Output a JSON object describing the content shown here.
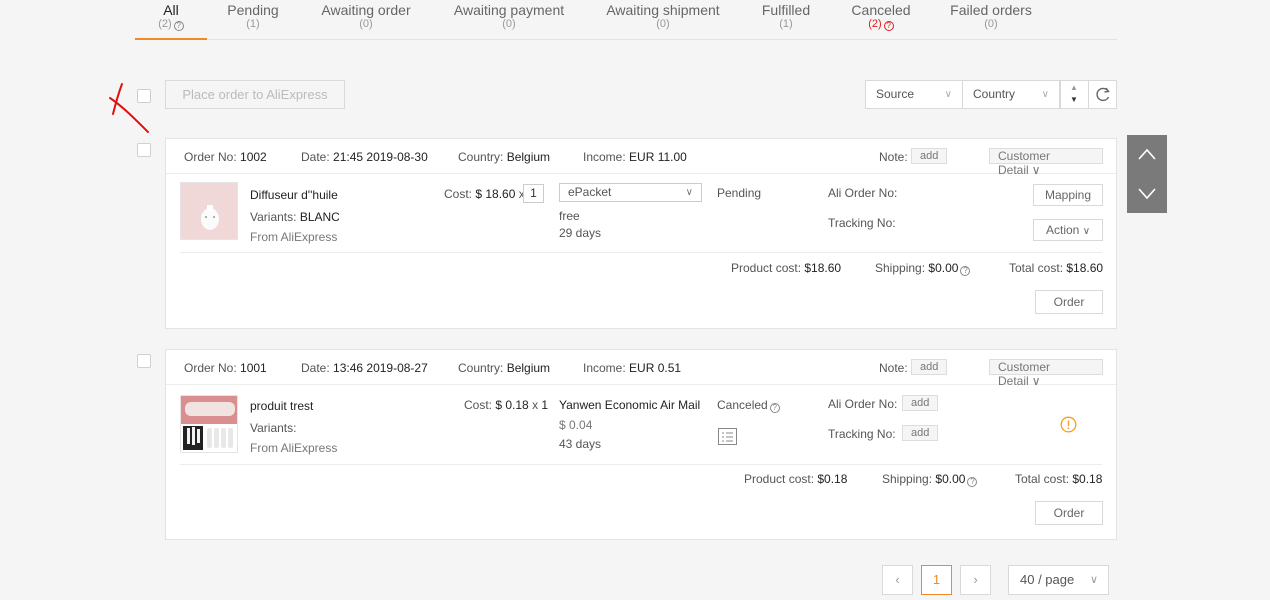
{
  "tabs": [
    {
      "label": "All",
      "count": "(2)",
      "active": true
    },
    {
      "label": "Pending",
      "count": "(1)"
    },
    {
      "label": "Awaiting order",
      "count": "(0)"
    },
    {
      "label": "Awaiting payment",
      "count": "(0)"
    },
    {
      "label": "Awaiting shipment",
      "count": "(0)"
    },
    {
      "label": "Fulfilled",
      "count": "(1)"
    },
    {
      "label": "Canceled",
      "count": "(2)"
    },
    {
      "label": "Failed orders",
      "count": "(0)"
    }
  ],
  "toolbar": {
    "place_order_label": "Place order to AliExpress",
    "source_label": "Source",
    "country_label": "Country"
  },
  "labels": {
    "order_no": "Order No:",
    "date": "Date:",
    "country": "Country:",
    "income": "Income:",
    "note": "Note:",
    "add": "add",
    "customer_detail": "Customer Detail",
    "cost": "Cost:",
    "variants": "Variants:",
    "from": "From AliExpress",
    "ali_order_no": "Ali Order No:",
    "tracking_no": "Tracking No:",
    "mapping": "Mapping",
    "action": "Action",
    "product_cost": "Product cost:",
    "shipping": "Shipping:",
    "total_cost": "Total cost:",
    "order_button": "Order"
  },
  "orders": [
    {
      "order_no": "1002",
      "date": "21:45 2019-08-30",
      "country": "Belgium",
      "income": "EUR 11.00",
      "product_name": "Diffuseur d''huile",
      "variant": "BLANC",
      "cost": "$ 18.60",
      "multiply": "x",
      "qty": "1",
      "shipping_method": "ePacket",
      "shipping_price": "free",
      "shipping_days": "29 days",
      "status": "Pending",
      "product_cost": "$18.60",
      "shipping_cost": "$0.00",
      "total_cost": "$18.60"
    },
    {
      "order_no": "1001",
      "date": "13:46 2019-08-27",
      "country": "Belgium",
      "income": "EUR 0.51",
      "product_name": "produit trest",
      "variant": "",
      "cost": "$ 0.18",
      "multiply": "x",
      "qty": "1",
      "shipping_method": "Yanwen Economic Air Mail",
      "shipping_price": "$ 0.04",
      "shipping_days": "43 days",
      "status": "Canceled",
      "product_cost": "$0.18",
      "shipping_cost": "$0.00",
      "total_cost": "$0.18"
    }
  ],
  "pagination": {
    "current_page": "1",
    "per_page": "40 / page"
  },
  "colors": {
    "accent": "#f08a24",
    "danger": "#e02020",
    "warning": "#f0a020",
    "annotation": "#e01010"
  }
}
